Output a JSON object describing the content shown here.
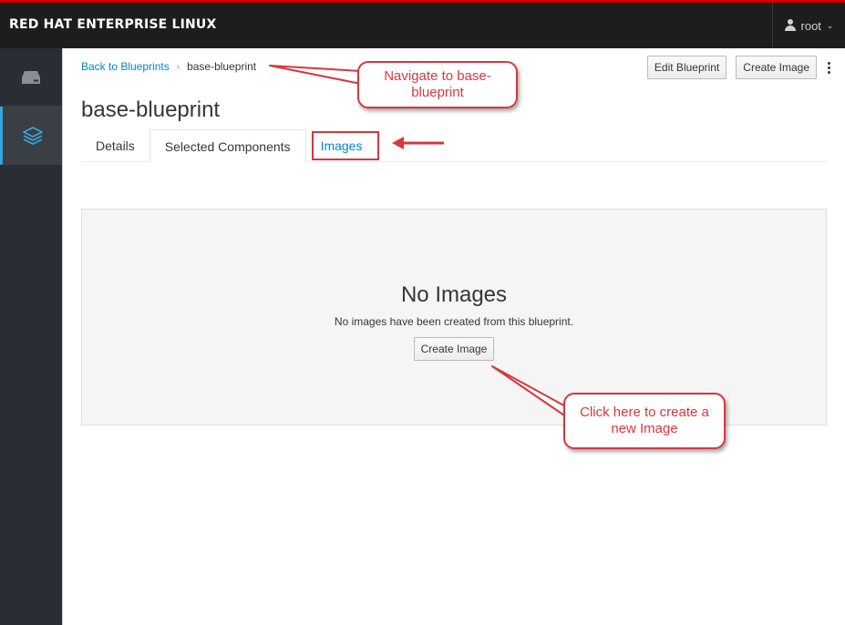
{
  "app": {
    "brand": "RED HAT ENTERPRISE LINUX"
  },
  "user": {
    "name": "root",
    "icon": "user-icon",
    "caret": "⌄"
  },
  "sidebar": {
    "items": [
      {
        "icon": "server-icon",
        "active": false
      },
      {
        "icon": "layers-icon",
        "active": true
      }
    ]
  },
  "breadcrumb": {
    "back_link": "Back to Blueprints",
    "separator": "›",
    "current": "base-blueprint"
  },
  "actions": {
    "edit_blueprint": "Edit Blueprint",
    "create_image": "Create Image"
  },
  "page": {
    "title": "base-blueprint"
  },
  "tabs": [
    {
      "label": "Details"
    },
    {
      "label": "Selected Components"
    },
    {
      "label": "Images"
    }
  ],
  "empty_state": {
    "title": "No Images",
    "text": "No images have been created from this blueprint.",
    "button": "Create Image"
  },
  "annotations": {
    "callout_1": "Navigate to base-blueprint",
    "callout_2": "Click here to create a new Image",
    "color": "#d9363e"
  },
  "colors": {
    "topbar": "#1d1d1d",
    "sidebar": "#292e34",
    "accent": "#0088ce",
    "active_indicator": "#39a5dc"
  }
}
